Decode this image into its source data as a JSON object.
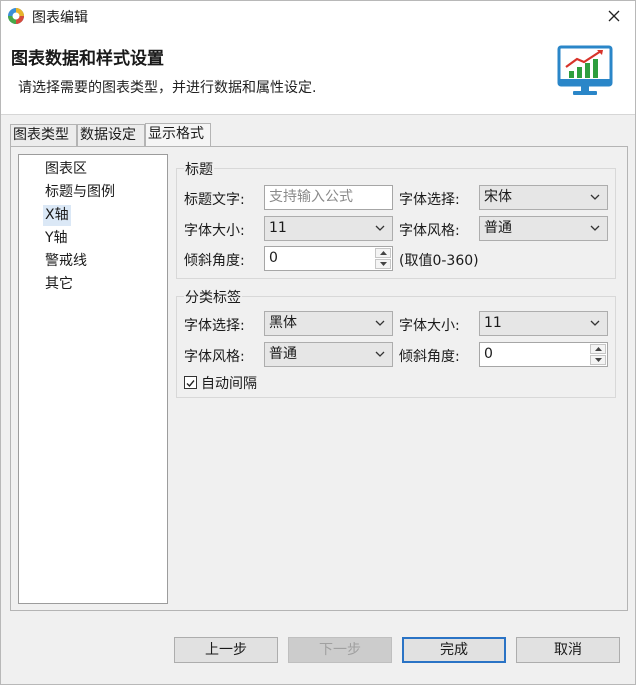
{
  "window": {
    "title": "图表编辑"
  },
  "banner": {
    "title": "图表数据和样式设置",
    "description": "请选择需要的图表类型，并进行数据和属性设定."
  },
  "tabs": [
    {
      "label": "图表类型",
      "active": false
    },
    {
      "label": "数据设定",
      "active": false
    },
    {
      "label": "显示格式",
      "active": true
    }
  ],
  "tree": {
    "items": [
      "图表区",
      "标题与图例",
      "X轴",
      "Y轴",
      "警戒线",
      "其它"
    ],
    "selected": "X轴"
  },
  "title_group": {
    "label": "标题",
    "text_label": "标题文字:",
    "text_placeholder": "支持输入公式",
    "font_label": "字体选择:",
    "font_value": "宋体",
    "size_label": "字体大小:",
    "size_value": "11",
    "style_label": "字体风格:",
    "style_value": "普通",
    "angle_label": "倾斜角度:",
    "angle_value": "0",
    "angle_hint": "(取值0-360)"
  },
  "category_group": {
    "label": "分类标签",
    "font_label": "字体选择:",
    "font_value": "黑体",
    "size_label": "字体大小:",
    "size_value": "11",
    "style_label": "字体风格:",
    "style_value": "普通",
    "angle_label": "倾斜角度:",
    "angle_value": "0",
    "auto_interval_label": "自动间隔",
    "auto_interval_checked": true
  },
  "buttons": {
    "prev": "上一步",
    "next": "下一步",
    "finish": "完成",
    "cancel": "取消"
  },
  "colors": {
    "accent": "#2a73c5",
    "selection": "#dbe8f6",
    "chart_icon_green": "#2e9e3e",
    "chart_icon_red": "#d8332a"
  }
}
